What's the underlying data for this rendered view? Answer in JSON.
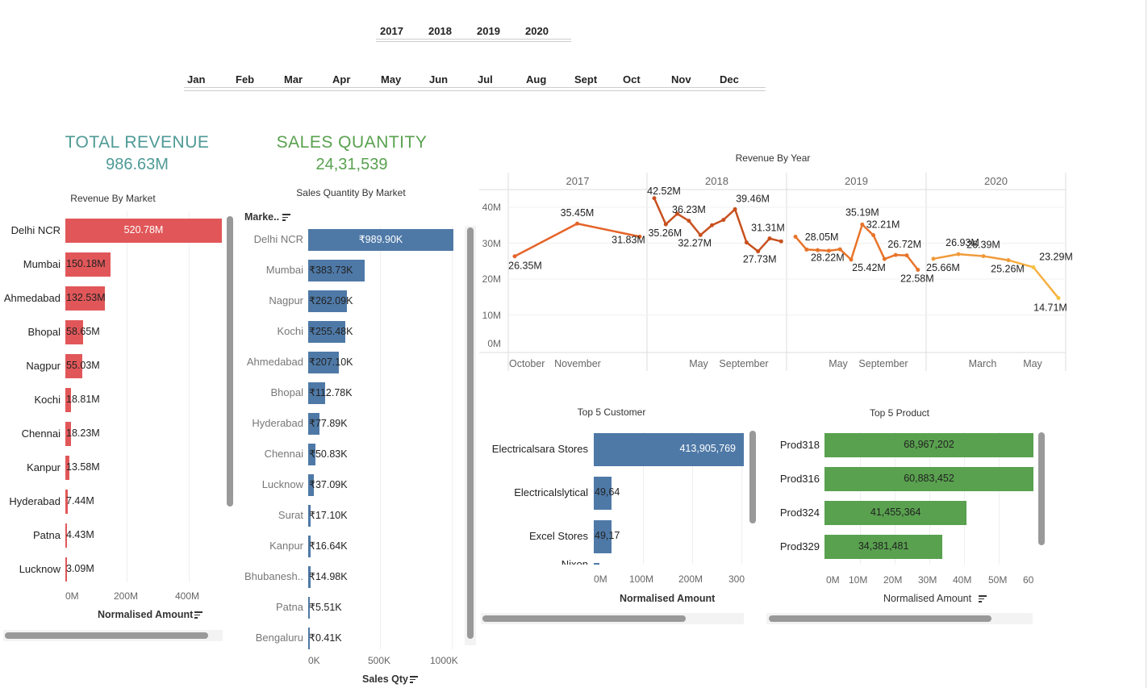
{
  "filters": {
    "years": [
      "2017",
      "2018",
      "2019",
      "2020"
    ],
    "months": [
      "Jan",
      "Feb",
      "Mar",
      "Apr",
      "May",
      "Jun",
      "Jul",
      "Aug",
      "Sept",
      "Oct",
      "Nov",
      "Dec"
    ]
  },
  "kpis": {
    "revenue": {
      "title": "TOTAL REVENUE",
      "value": "986.63M",
      "color": "#4e9a96"
    },
    "quantity": {
      "title": "SALES QUANTITY",
      "value": "24,31,539",
      "color": "#59a14f"
    }
  },
  "chart_data": [
    {
      "id": "revenue_by_market",
      "type": "bar",
      "orientation": "horizontal",
      "title": "Revenue By Market",
      "xlabel": "Normalised Amount",
      "xticks": [
        "0M",
        "200M",
        "400M"
      ],
      "xlim": [
        0,
        520
      ],
      "color": "#e15759",
      "categories": [
        "Delhi NCR",
        "Mumbai",
        "Ahmedabad",
        "Bhopal",
        "Nagpur",
        "Kochi",
        "Chennai",
        "Kanpur",
        "Hyderabad",
        "Patna",
        "Lucknow"
      ],
      "values": [
        520.78,
        150.18,
        132.53,
        58.65,
        55.03,
        18.81,
        18.23,
        13.58,
        7.44,
        4.43,
        3.09
      ],
      "labels": [
        "520.78M",
        "150.18M",
        "132.53M",
        "58.65M",
        "55.03M",
        "18.81M",
        "18.23M",
        "13.58M",
        "7.44M",
        "4.43M",
        "3.09M"
      ]
    },
    {
      "id": "sales_qty_by_market",
      "type": "bar",
      "orientation": "horizontal",
      "title": "Sales Quantity By Market",
      "header": "Marke..",
      "xlabel": "Sales Qty",
      "xticks": [
        "0K",
        "500K",
        "1000K"
      ],
      "xlim": [
        0,
        1000
      ],
      "color": "#4e79a7",
      "categories": [
        "Delhi NCR",
        "Mumbai",
        "Nagpur",
        "Kochi",
        "Ahmedabad",
        "Bhopal",
        "Hyderabad",
        "Chennai",
        "Lucknow",
        "Surat",
        "Kanpur",
        "Bhubanesh..",
        "Patna",
        "Bengaluru"
      ],
      "values": [
        989.9,
        383.73,
        262.09,
        255.48,
        207.1,
        112.78,
        77.89,
        50.83,
        37.09,
        17.1,
        16.64,
        14.98,
        5.51,
        0.41
      ],
      "labels": [
        "₹989.90K",
        "₹383.73K",
        "₹262.09K",
        "₹255.48K",
        "₹207.10K",
        "₹112.78K",
        "₹77.89K",
        "₹50.83K",
        "₹37.09K",
        "₹17.10K",
        "₹16.64K",
        "₹14.98K",
        "₹5.51K",
        "₹0.41K"
      ]
    },
    {
      "id": "revenue_by_year",
      "type": "line",
      "title": "Revenue By Year",
      "yticks": [
        "40M",
        "30M",
        "20M",
        "10M",
        "0M"
      ],
      "ylim": [
        0,
        40
      ],
      "panels": [
        {
          "year": "2017",
          "xticks": [
            "October",
            "November"
          ],
          "points": [
            {
              "m": 0,
              "v": 26.35,
              "label": "26.35M"
            },
            {
              "m": 1,
              "v": 35.45,
              "label": "35.45M"
            },
            {
              "m": 2,
              "v": 31.83,
              "label": "31.83M"
            }
          ]
        },
        {
          "year": "2018",
          "xticks": [
            "May",
            "September"
          ],
          "points": [
            {
              "m": 0,
              "v": 42.52,
              "label": "42.52M"
            },
            {
              "m": 1,
              "v": 35.26,
              "label": "35.26M"
            },
            {
              "m": 2,
              "v": 38.2,
              "label": ""
            },
            {
              "m": 3,
              "v": 36.23,
              "label": "36.23M"
            },
            {
              "m": 4,
              "v": 32.27,
              "label": "32.27M"
            },
            {
              "m": 5,
              "v": 35.0,
              "label": ""
            },
            {
              "m": 6,
              "v": 36.5,
              "label": ""
            },
            {
              "m": 7,
              "v": 39.46,
              "label": "39.46M"
            },
            {
              "m": 8,
              "v": 30.2,
              "label": ""
            },
            {
              "m": 9,
              "v": 27.73,
              "label": "27.73M"
            },
            {
              "m": 10,
              "v": 31.31,
              "label": "31.31M"
            },
            {
              "m": 11,
              "v": 30.5,
              "label": ""
            }
          ]
        },
        {
          "year": "2019",
          "xticks": [
            "May",
            "September"
          ],
          "points": [
            {
              "m": 0,
              "v": 31.8,
              "label": ""
            },
            {
              "m": 1,
              "v": 28.22,
              "label": "28.22M"
            },
            {
              "m": 2,
              "v": 28.05,
              "label": "28.05M"
            },
            {
              "m": 3,
              "v": 27.9,
              "label": ""
            },
            {
              "m": 4,
              "v": 28.3,
              "label": ""
            },
            {
              "m": 5,
              "v": 25.42,
              "label": "25.42M"
            },
            {
              "m": 6,
              "v": 35.19,
              "label": "35.19M"
            },
            {
              "m": 7,
              "v": 32.21,
              "label": "32.21M"
            },
            {
              "m": 8,
              "v": 25.6,
              "label": ""
            },
            {
              "m": 9,
              "v": 26.72,
              "label": "26.72M"
            },
            {
              "m": 10,
              "v": 26.6,
              "label": ""
            },
            {
              "m": 11,
              "v": 22.58,
              "label": "22.58M"
            }
          ]
        },
        {
          "year": "2020",
          "xticks": [
            "March",
            "May"
          ],
          "points": [
            {
              "m": 0,
              "v": 25.66,
              "label": "25.66M"
            },
            {
              "m": 1,
              "v": 26.93,
              "label": "26.93M"
            },
            {
              "m": 2,
              "v": 26.39,
              "label": "26.39M"
            },
            {
              "m": 3,
              "v": 25.26,
              "label": "25.26M"
            },
            {
              "m": 4,
              "v": 23.29,
              "label": "23.29M"
            },
            {
              "m": 5,
              "v": 14.71,
              "label": "14.71M"
            }
          ]
        }
      ]
    },
    {
      "id": "top5_customer",
      "type": "bar",
      "orientation": "horizontal",
      "title": "Top 5 Customer",
      "xlabel": "Normalised Amount",
      "xticks": [
        "0M",
        "100M",
        "200M",
        "300"
      ],
      "xlim": [
        0,
        300
      ],
      "color": "#4e79a7",
      "categories": [
        "Electricalsara Stores",
        "Electricalslytical",
        "Excel Stores",
        "Nixon"
      ],
      "values": [
        413.905769,
        49.64,
        49.17,
        15.0
      ],
      "labels": [
        "413,905,769",
        "49,64",
        "49,17",
        ""
      ]
    },
    {
      "id": "top5_product",
      "type": "bar",
      "orientation": "horizontal",
      "title": "Top 5 Product",
      "xlabel": "Normalised Amount",
      "xticks": [
        "0M",
        "10M",
        "20M",
        "30M",
        "40M",
        "50M",
        "60"
      ],
      "xlim": [
        0,
        60
      ],
      "color": "#59a14f",
      "categories": [
        "Prod318",
        "Prod316",
        "Prod324",
        "Prod329"
      ],
      "values": [
        68.967202,
        60.883452,
        41.455364,
        34.381481
      ],
      "labels": [
        "68,967,202",
        "60,883,452",
        "41,455,364",
        "34,381,481"
      ]
    }
  ]
}
